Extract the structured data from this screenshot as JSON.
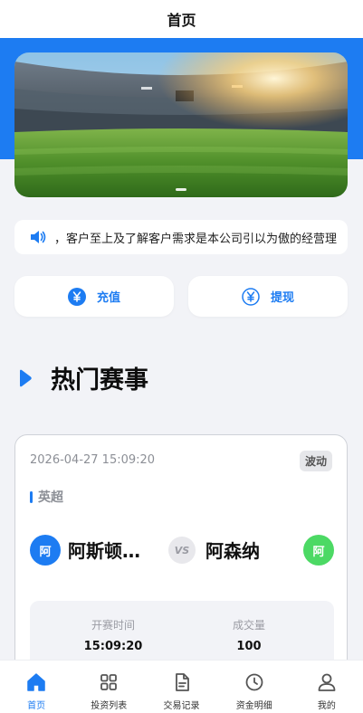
{
  "header": {
    "title": "首页"
  },
  "banner": {
    "image": "stadium-photo"
  },
  "notice": {
    "icon": "speaker-icon",
    "text": "，客户至上及了解客户需求是本公司引以为傲的经营理"
  },
  "actions": {
    "recharge": {
      "label": "充值",
      "icon": "yen-circle-icon"
    },
    "withdraw": {
      "label": "提现",
      "icon": "yen-circle-icon"
    }
  },
  "section": {
    "title": "热门赛事",
    "icon": "play-triangle-icon"
  },
  "match": {
    "datetime": "2026-04-27 15:09:20",
    "badge": "波动",
    "league": "英超",
    "home": {
      "avatar_text": "阿",
      "name": "阿斯顿…"
    },
    "vs": "VS",
    "away": {
      "avatar_text": "阿",
      "name": "阿森纳"
    },
    "stats": {
      "open_time_label": "开赛时间",
      "open_time_value": "15:09:20",
      "volume_label": "成交量",
      "volume_value": "100"
    }
  },
  "tabbar": {
    "items": [
      {
        "label": "首页",
        "icon": "home-icon",
        "active": true
      },
      {
        "label": "投资列表",
        "icon": "grid-icon",
        "active": false
      },
      {
        "label": "交易记录",
        "icon": "document-icon",
        "active": false
      },
      {
        "label": "资金明细",
        "icon": "clock-icon",
        "active": false
      },
      {
        "label": "我的",
        "icon": "user-icon",
        "active": false
      }
    ]
  },
  "colors": {
    "accent": "#1d7cf2",
    "away_avatar": "#4cd964",
    "page_bg": "#f2f3f7"
  }
}
